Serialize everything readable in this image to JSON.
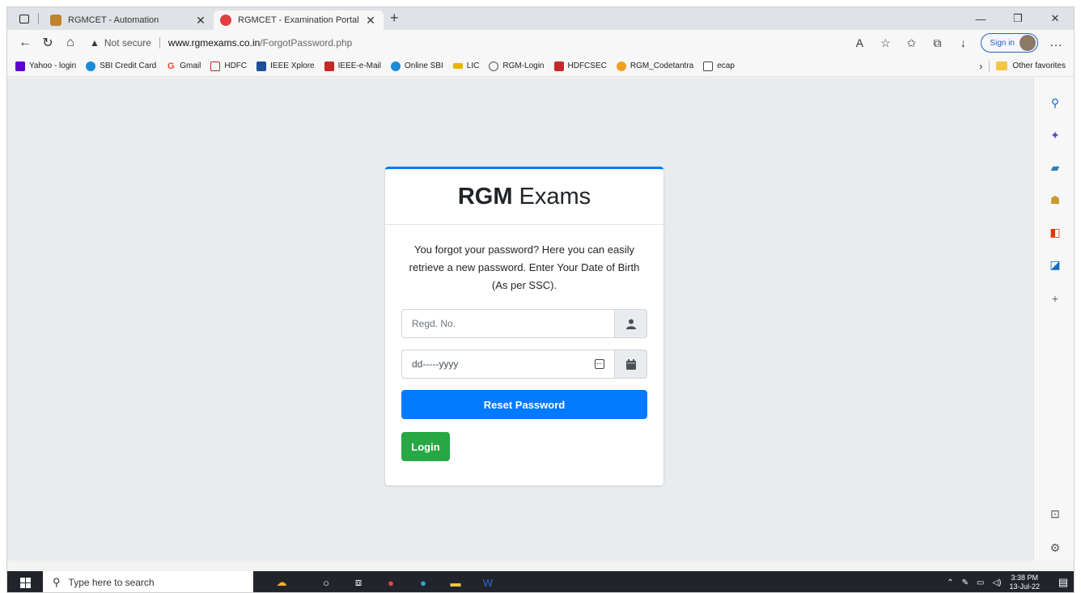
{
  "browser": {
    "tabs": [
      {
        "title": "RGMCET - Automation",
        "favicon_color": "#c0822b",
        "active": false
      },
      {
        "title": "RGMCET - Examination Portal",
        "favicon_color": "#e04040",
        "active": true
      }
    ],
    "address": {
      "security_label": "Not secure",
      "url_host": "www.rgmexams.co.in",
      "url_path": "/ForgotPassword.php"
    },
    "signin_label": "Sign in",
    "bookmarks": [
      {
        "label": "Yahoo - login",
        "color": "#6001d2"
      },
      {
        "label": "SBI Credit Card",
        "color": "#1a8cd8"
      },
      {
        "label": "Gmail",
        "color": "#ea4335"
      },
      {
        "label": "HDFC",
        "color": "#c62828"
      },
      {
        "label": "IEEE Xplore",
        "color": "#1e4f9c"
      },
      {
        "label": "IEEE-e-Mail",
        "color": "#c62828"
      },
      {
        "label": "Online SBI",
        "color": "#1a8cd8"
      },
      {
        "label": "LIC",
        "color": "#e6b400"
      },
      {
        "label": "RGM-Login",
        "color": "#555555"
      },
      {
        "label": "HDFCSEC",
        "color": "#c62828"
      },
      {
        "label": "RGM_Codetantra",
        "color": "#f0a020"
      },
      {
        "label": "ecap",
        "color": "#ffffff"
      }
    ],
    "other_favorites": "Other favorites"
  },
  "card": {
    "brand_bold": "RGM",
    "brand_rest": "Exams",
    "message": "You forgot your password? Here you can easily retrieve a new password. Enter Your Date of Birth (As per SSC).",
    "regd_placeholder": "Regd. No.",
    "dob_value": "dd-----yyyy",
    "reset_label": "Reset Password",
    "login_label": "Login"
  },
  "taskbar": {
    "search_placeholder": "Type here to search",
    "time": "3:38 PM",
    "date": "13-Jul-22"
  },
  "colors": {
    "primary": "#007bff",
    "success": "#28a745",
    "page_bg": "#e9ecef"
  }
}
